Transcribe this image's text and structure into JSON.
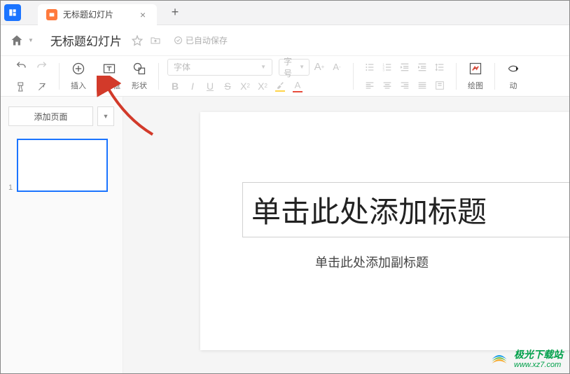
{
  "tab": {
    "title": "无标题幻灯片"
  },
  "header": {
    "doc_title": "无标题幻灯片",
    "save_status": "已自动保存"
  },
  "toolbar": {
    "insert_label": "插入",
    "textbox_label": "文本框",
    "shapes_label": "形状",
    "drawing_label": "绘图",
    "motion_label": "动",
    "font_placeholder": "字体",
    "size_placeholder": "字号"
  },
  "sidebar": {
    "add_slide_label": "添加页面",
    "slides": [
      {
        "number": "1"
      }
    ]
  },
  "slide": {
    "title_placeholder": "单击此处添加标题",
    "subtitle_placeholder": "单击此处添加副标题"
  },
  "watermark": {
    "name": "极光下载站",
    "url": "www.xz7.com"
  }
}
